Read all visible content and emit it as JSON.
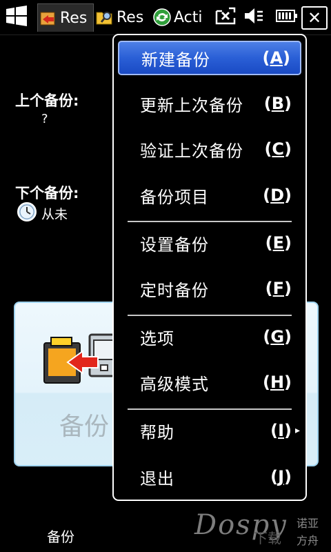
{
  "taskbar": {
    "tasks": [
      {
        "label": "Res",
        "icon": "restore-backup-icon"
      },
      {
        "label": "Res",
        "icon": "folder-search-icon"
      },
      {
        "label": "Acti",
        "icon": "activesync-icon"
      }
    ],
    "close_label": "✕"
  },
  "main": {
    "last_backup_label": "上个备份:",
    "last_backup_value": "?",
    "next_backup_label": "下个备份:",
    "next_backup_value": "从未",
    "backup_button_label": "备份",
    "bottom_label": "备份"
  },
  "menu": {
    "items": [
      {
        "label": "新建备份",
        "key": "A",
        "selected": true
      },
      {
        "label": "更新上次备份",
        "key": "B"
      },
      {
        "label": "验证上次备份",
        "key": "C"
      },
      {
        "label": "备份项目",
        "key": "D"
      },
      {
        "label": "设置备份",
        "key": "E"
      },
      {
        "label": "定时备份",
        "key": "F"
      },
      {
        "label": "选项",
        "key": "G"
      },
      {
        "label": "高级模式",
        "key": "H"
      },
      {
        "label": "帮助",
        "key": "I",
        "submenu": true
      },
      {
        "label": "退出",
        "key": "J"
      }
    ]
  },
  "watermark": {
    "brand": "Dospy",
    "cn_line1": "诺亚",
    "cn_line2": "方舟",
    "cn_mid": "下载"
  },
  "colors": {
    "menu_highlight": "#2a5fd6",
    "panel_bg": "#e4f3fb",
    "panel_border": "#9fd3ef"
  }
}
